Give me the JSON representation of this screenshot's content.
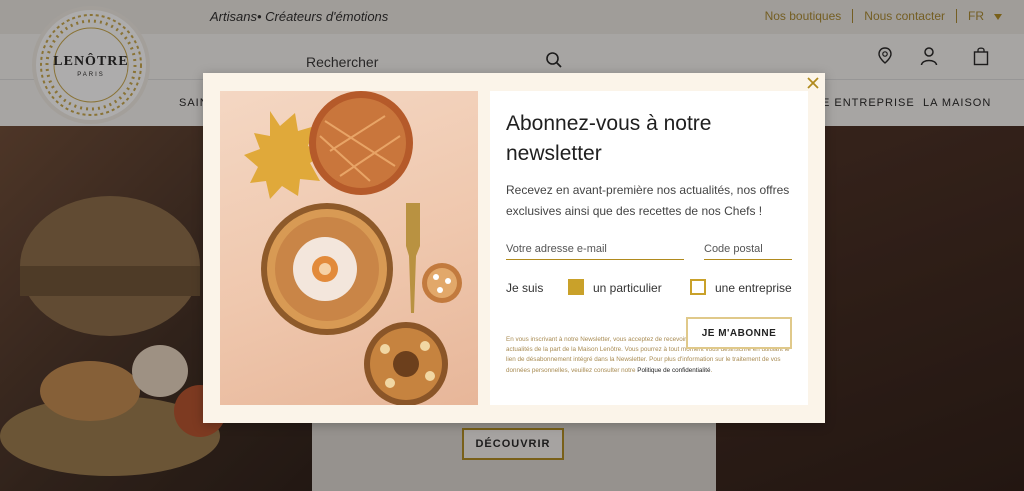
{
  "topbar": {
    "tagline": "Artisans• Créateurs d'émotions",
    "links": [
      "Nos boutiques",
      "Nous contacter"
    ],
    "language": "FR"
  },
  "header": {
    "search_placeholder": "Rechercher"
  },
  "logo": {
    "name": "LENÔTRE",
    "sub": "PARIS"
  },
  "nav": {
    "items": [
      "SAIN",
      "E ENTREPRISE",
      "LA MAISON"
    ]
  },
  "hero": {
    "cta_label": "DÉCOUVRIR"
  },
  "modal": {
    "title": "Abonnez-vous à notre newsletter",
    "description": "Recevez en avant-première nos actualités, nos offres exclusives ainsi que des recettes de nos Chefs !",
    "email_placeholder": "Votre adresse e-mail",
    "postal_placeholder": "Code postal",
    "je_suis": "Je suis",
    "options": [
      {
        "label": "un particulier",
        "checked": true
      },
      {
        "label": "une entreprise",
        "checked": false
      }
    ],
    "subscribe_label": "JE M'ABONNE",
    "legal_text": "En vous inscrivant à notre Newsletter, vous acceptez de recevoir les communications, promotions et actualités de la part de la Maison Lenôtre. Vous pourrez à tout moment vous désinscrire en utilisant le lien de désabonnement intégré dans la Newsletter. Pour plus d'information sur le traitement de vos données personnelles, veuillez consulter notre",
    "legal_link": "Politique de confidentialité",
    "legal_end": "."
  },
  "colors": {
    "accent_gold": "#b08a1e",
    "modal_bg": "#fbf4e9",
    "checkbox_gold": "#c9a12a"
  },
  "icons": [
    "store-locator-icon",
    "account-icon",
    "cart-icon",
    "search-icon",
    "close-icon",
    "chevron-down-icon"
  ]
}
